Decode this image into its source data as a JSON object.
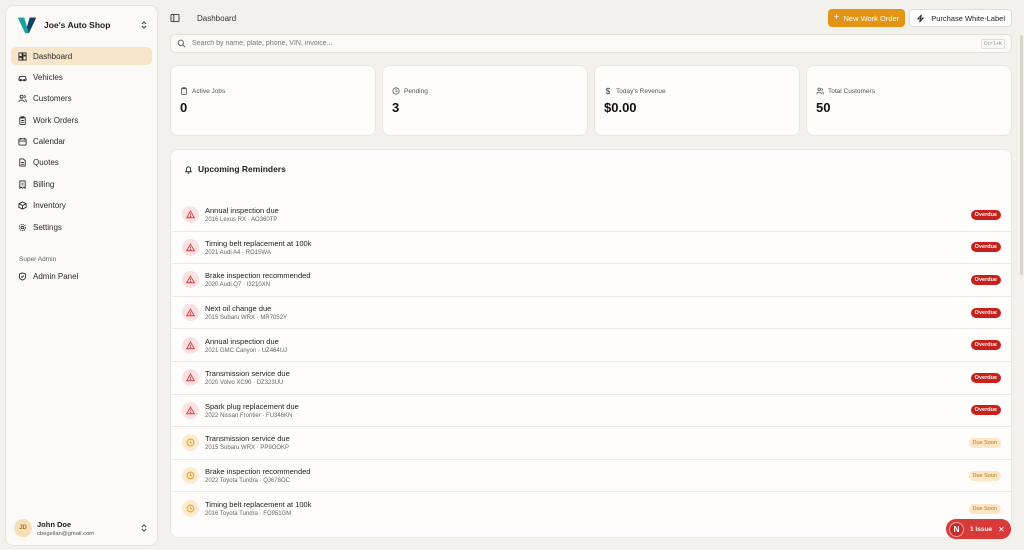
{
  "brand": {
    "name": "Joe's Auto Shop"
  },
  "nav": {
    "items": [
      {
        "label": "Dashboard",
        "icon": "dashboard-icon",
        "active": true
      },
      {
        "label": "Vehicles",
        "icon": "car-icon"
      },
      {
        "label": "Customers",
        "icon": "users-icon"
      },
      {
        "label": "Work Orders",
        "icon": "clipboard-icon"
      },
      {
        "label": "Calendar",
        "icon": "calendar-icon"
      },
      {
        "label": "Quotes",
        "icon": "file-icon"
      },
      {
        "label": "Billing",
        "icon": "receipt-icon"
      },
      {
        "label": "Inventory",
        "icon": "box-icon"
      },
      {
        "label": "Settings",
        "icon": "gear-icon"
      }
    ],
    "section_label": "Super Admin",
    "admin_label": "Admin Panel"
  },
  "user": {
    "initials": "JD",
    "name": "John Doe",
    "email": "cbegellan@gmail.com"
  },
  "topbar": {
    "breadcrumb": "Dashboard",
    "new_work_order": "New Work Order",
    "purchase": "Purchase White-Label"
  },
  "search": {
    "placeholder": "Search by name, plate, phone, VIN, invoice...",
    "shortcut": "Ctrl+K"
  },
  "stats": [
    {
      "label": "Active Jobs",
      "value": "0",
      "icon": "clipboard-icon"
    },
    {
      "label": "Pending",
      "value": "3",
      "icon": "clock-icon"
    },
    {
      "label": "Today's Revenue",
      "value": "$0.00",
      "icon": "dollar-icon"
    },
    {
      "label": "Total Customers",
      "value": "50",
      "icon": "users-icon"
    }
  ],
  "reminders": {
    "title": "Upcoming Reminders",
    "items": [
      {
        "title": "Annual inspection due",
        "sub": "2016 Lexus RX · AO360TP",
        "status": "Overdue",
        "kind": "overdue"
      },
      {
        "title": "Timing belt replacement at 100k",
        "sub": "2021 Audi A4 · RO15WA",
        "status": "Overdue",
        "kind": "overdue"
      },
      {
        "title": "Brake inspection recommended",
        "sub": "2020 Audi Q7 · I3210XN",
        "status": "Overdue",
        "kind": "overdue"
      },
      {
        "title": "Next oil change due",
        "sub": "2015 Subaru WRX · MR7052Y",
        "status": "Overdue",
        "kind": "overdue"
      },
      {
        "title": "Annual inspection due",
        "sub": "2021 GMC Canyon · UZ464UJ",
        "status": "Overdue",
        "kind": "overdue"
      },
      {
        "title": "Transmission service due",
        "sub": "2020 Volvo XC90 · DZ323UU",
        "status": "Overdue",
        "kind": "overdue"
      },
      {
        "title": "Spark plug replacement due",
        "sub": "2022 Nissan Frontier · FU346KN",
        "status": "Overdue",
        "kind": "overdue"
      },
      {
        "title": "Transmission service due",
        "sub": "2015 Subaru WRX · PP9OOKP",
        "status": "Due Soon",
        "kind": "soon"
      },
      {
        "title": "Brake inspection recommended",
        "sub": "2022 Toyota Tundra · QJ678OC",
        "status": "Due Soon",
        "kind": "soon"
      },
      {
        "title": "Timing belt replacement at 100k",
        "sub": "2016 Toyota Tundra · FO951GM",
        "status": "Due Soon",
        "kind": "soon"
      }
    ]
  },
  "issue": {
    "n": "N",
    "label": "1 Issue",
    "close": "✕"
  },
  "colors": {
    "accent": "#e39414",
    "overdue": "#c9201c",
    "active_nav": "#f8e6cb"
  }
}
